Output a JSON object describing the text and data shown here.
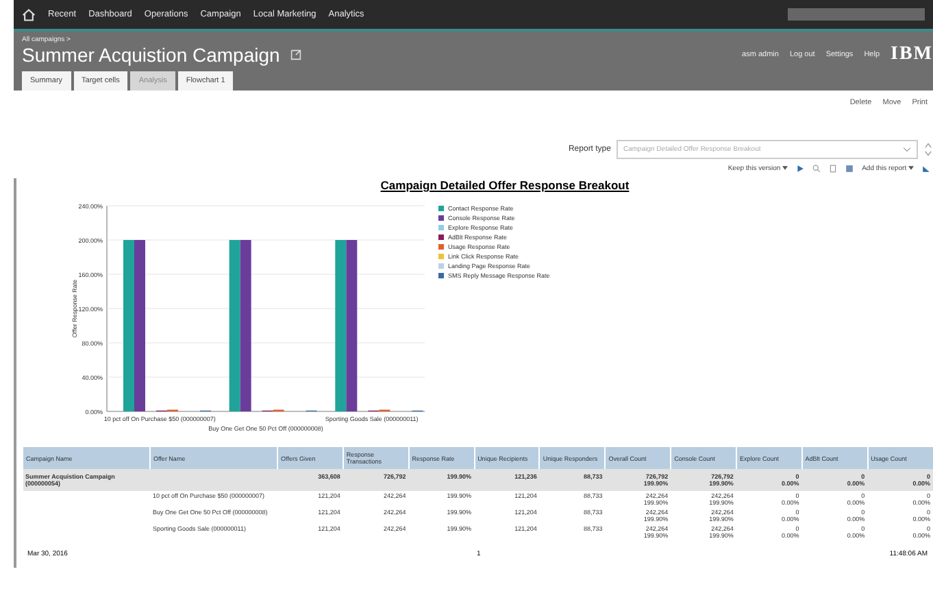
{
  "nav": {
    "items": [
      "Recent",
      "Dashboard",
      "Operations",
      "Campaign",
      "Local Marketing",
      "Analytics"
    ]
  },
  "header": {
    "breadcrumb": "All campaigns >",
    "title": "Summer Acquistion Campaign",
    "user_links": [
      "asm admin",
      "Log out",
      "Settings",
      "Help"
    ],
    "logo": "IBM"
  },
  "tabs": [
    {
      "label": "Summary",
      "selected": false
    },
    {
      "label": "Target cells",
      "selected": false
    },
    {
      "label": "Analysis",
      "selected": true
    },
    {
      "label": "Flowchart 1",
      "selected": false
    }
  ],
  "actions": [
    "Delete",
    "Move",
    "Print"
  ],
  "report_type": {
    "label": "Report type",
    "value": "Campaign Detailed Offer Response Breakout"
  },
  "report_toolbar": {
    "view_menu": "Keep this version",
    "run_menu": "Add this report"
  },
  "report": {
    "title": "Campaign Detailed Offer Response Breakout",
    "chart_data": {
      "type": "bar",
      "ylabel": "Offer Response Rate",
      "grid": true,
      "legend": true,
      "categories": [
        "10 pct off On Purchase $50 (000000007)",
        "Buy One Get One 50 Pct Off (000000008)",
        "Sporting Goods Sale (000000011)"
      ],
      "ylim": [
        0,
        240
      ],
      "yticks": [
        {
          "value": 0,
          "label": "0.00%"
        },
        {
          "value": 40,
          "label": "40.00%"
        },
        {
          "value": 80,
          "label": "80.00%"
        },
        {
          "value": 120,
          "label": "120.00%"
        },
        {
          "value": 160,
          "label": "160.00%"
        },
        {
          "value": 200,
          "label": "200.00%"
        },
        {
          "value": 240,
          "label": "240.00%"
        }
      ],
      "series": [
        {
          "name": "Contact Response Rate",
          "color": "#1fa39a",
          "values": [
            200,
            200,
            200
          ]
        },
        {
          "name": "Console Response Rate",
          "color": "#6a3d9a",
          "values": [
            200,
            200,
            200
          ]
        },
        {
          "name": "Explore Response Rate",
          "color": "#8fcde8",
          "values": [
            0,
            0,
            0
          ]
        },
        {
          "name": "AdBlt Response Rate",
          "color": "#8c1b5e",
          "values": [
            1,
            1,
            1
          ]
        },
        {
          "name": "Usage Response Rate",
          "color": "#e0602a",
          "values": [
            2,
            2,
            2
          ]
        },
        {
          "name": "Link Click Response Rate",
          "color": "#f0c23c",
          "values": [
            0,
            0,
            0
          ]
        },
        {
          "name": "Landing Page Response Rate",
          "color": "#b9d3e2",
          "values": [
            0,
            0,
            0
          ]
        },
        {
          "name": "SMS Reply Message Response Rate",
          "color": "#3b6aa0",
          "values": [
            1,
            1,
            1
          ]
        }
      ]
    },
    "table": {
      "columns": [
        "Campaign Name",
        "Offer Name",
        "Offers Given",
        "Response Transactions",
        "Response Rate",
        "Unique Recipients",
        "Unique Responders",
        "Overall Count",
        "Console Count",
        "Explore Count",
        "AdBlt Count",
        "Usage Count"
      ],
      "rows": [
        {
          "kind": "total",
          "cells": [
            "Summer Acquistion Campaign (000000054)",
            "",
            "363,608",
            "726,792",
            "199.90%",
            "121,236",
            "88,733",
            "726,792\n199.90%",
            "726,792\n199.90%",
            "0\n0.00%",
            "0\n0.00%",
            "0\n0.00%"
          ]
        },
        {
          "kind": "detail",
          "cells": [
            "",
            "10 pct off On Purchase $50 (000000007)",
            "121,204",
            "242,264",
            "199.90%",
            "121,204",
            "88,733",
            "242,264\n199.90%",
            "242,264\n199.90%",
            "0\n0.00%",
            "0\n0.00%",
            "0\n0.00%"
          ]
        },
        {
          "kind": "detail",
          "cells": [
            "",
            "Buy One Get One 50 Pct Off (000000008)",
            "121,204",
            "242,264",
            "199.90%",
            "121,204",
            "88,733",
            "242,264\n199.90%",
            "242,264\n199.90%",
            "0\n0.00%",
            "0\n0.00%",
            "0\n0.00%"
          ]
        },
        {
          "kind": "detail",
          "cells": [
            "",
            "Sporting Goods Sale (000000011)",
            "121,204",
            "242,264",
            "199.90%",
            "121,204",
            "88,733",
            "242,264\n199.90%",
            "242,264\n199.90%",
            "0\n0.00%",
            "0\n0.00%",
            "0\n0.00%"
          ]
        }
      ]
    },
    "footer": {
      "date": "Mar 30, 2016",
      "page": "1",
      "time": "11:48:06 AM"
    }
  }
}
